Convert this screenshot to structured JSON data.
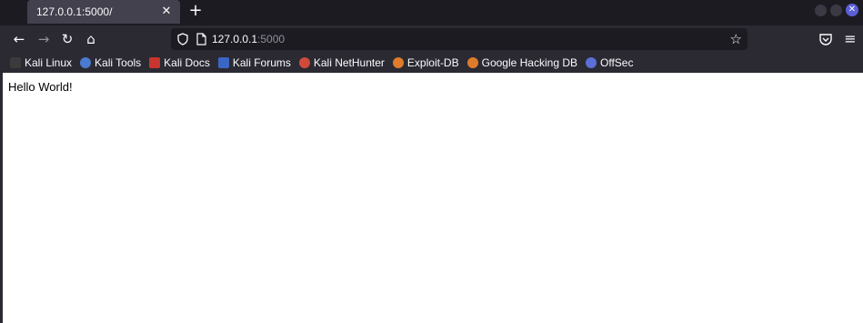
{
  "tab": {
    "title": "127.0.0.1:5000/",
    "close_glyph": "✕",
    "new_tab_glyph": "+"
  },
  "window_controls": {
    "close_glyph": "✕"
  },
  "toolbar": {
    "back_glyph": "←",
    "forward_glyph": "→",
    "reload_glyph": "↻",
    "home_glyph": "⌂",
    "url_host": "127.0.0.1",
    "url_port": ":5000",
    "star_glyph": "☆",
    "menu_glyph": "≡"
  },
  "bookmarks": [
    {
      "label": "Kali Linux",
      "icon": "kali-dragon-icon",
      "color": "#3b3b3b"
    },
    {
      "label": "Kali Tools",
      "icon": "kali-tools-icon",
      "color": "#4a7bd0"
    },
    {
      "label": "Kali Docs",
      "icon": "kali-docs-icon",
      "color": "#c8342e"
    },
    {
      "label": "Kali Forums",
      "icon": "kali-forums-icon",
      "color": "#3a66c4"
    },
    {
      "label": "Kali NetHunter",
      "icon": "nethunter-icon",
      "color": "#d04a3a"
    },
    {
      "label": "Exploit-DB",
      "icon": "exploit-db-icon",
      "color": "#e07b2a"
    },
    {
      "label": "Google Hacking DB",
      "icon": "ghdb-icon",
      "color": "#e07b2a"
    },
    {
      "label": "OffSec",
      "icon": "offsec-icon",
      "color": "#5b6fd6"
    }
  ],
  "page": {
    "text": "Hello World!"
  }
}
